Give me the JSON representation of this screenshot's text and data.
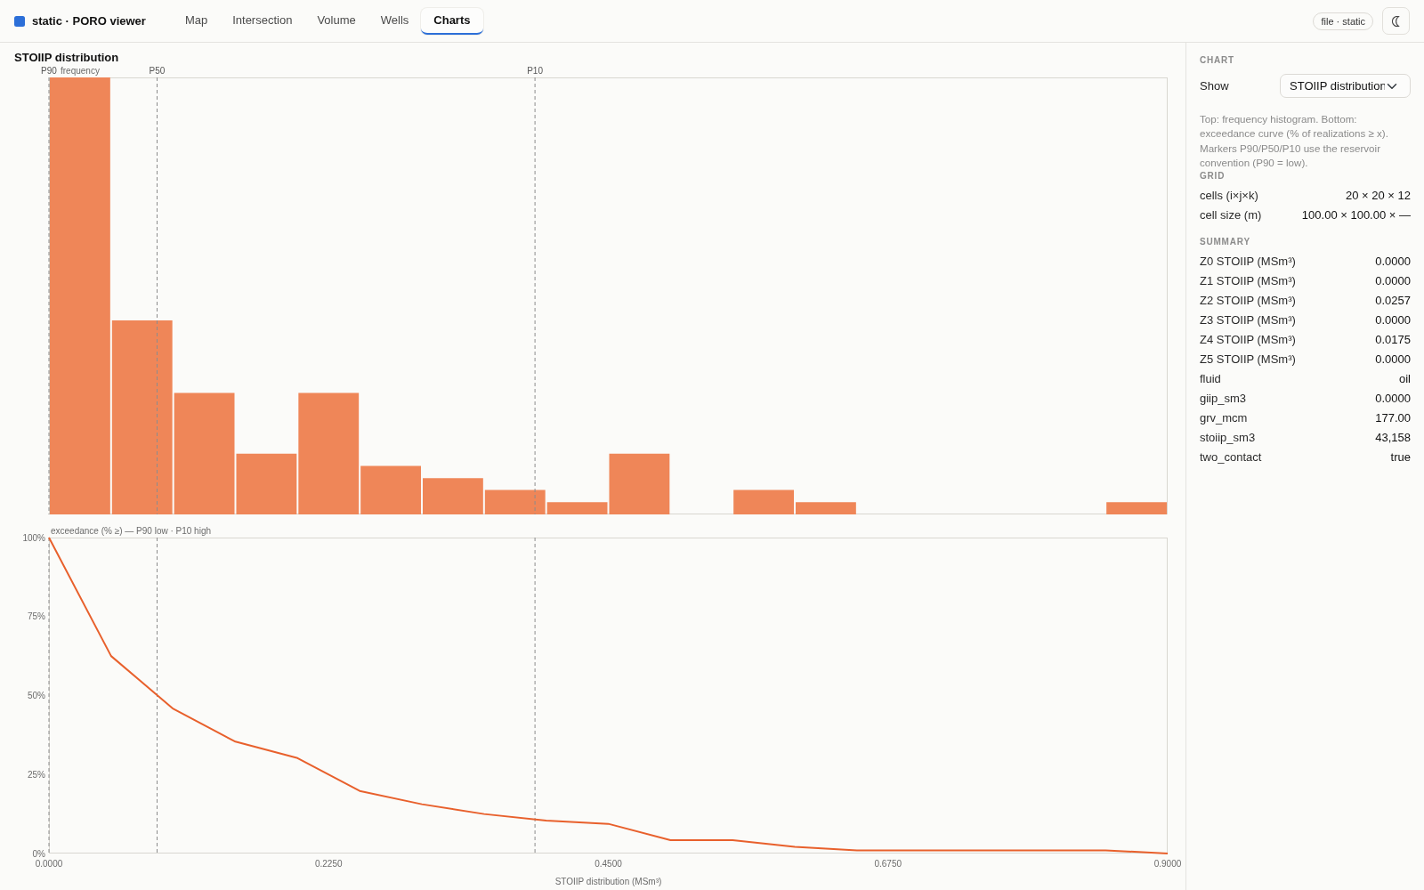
{
  "header": {
    "brand": "static · PORO viewer",
    "tabs": [
      {
        "label": "Map",
        "selected": false
      },
      {
        "label": "Intersection",
        "selected": false
      },
      {
        "label": "Volume",
        "selected": false
      },
      {
        "label": "Wells",
        "selected": false
      },
      {
        "label": "Charts",
        "selected": true
      }
    ],
    "file_badge": "file · static"
  },
  "chart_panel": {
    "title": "STOIIP distribution",
    "markers": [
      {
        "label": "P90"
      },
      {
        "label": "P50"
      },
      {
        "label": "P10"
      }
    ],
    "histogram": {
      "axis_label": "frequency"
    },
    "exceedance": {
      "chart_data": {
        "type": "line",
        "title": "exceedance (% ≥) — P90 low · P10 high",
        "xlabel": "STOIIP distribution (MSm³)",
        "x": [
          0,
          0.05,
          0.1,
          0.15,
          0.2,
          0.25,
          0.3,
          0.35,
          0.4,
          0.45,
          0.5,
          0.55,
          0.6,
          0.65,
          0.7,
          0.75,
          0.8,
          0.85,
          0.9
        ],
        "values": [
          100,
          62.5,
          45.8,
          35.4,
          30.2,
          19.8,
          15.6,
          12.5,
          10.4,
          9.4,
          4.2,
          4.2,
          2.1,
          1.0,
          1.0,
          1.0,
          1.0,
          1.0,
          0
        ],
        "xlim": [
          0,
          0.9
        ],
        "ylim": [
          0,
          100
        ],
        "xticks": [
          {
            "value": 0,
            "label": "0.0000"
          },
          {
            "value": 0.225,
            "label": "0.2250"
          },
          {
            "value": 0.45,
            "label": "0.4500"
          },
          {
            "value": 0.675,
            "label": "0.6750"
          },
          {
            "value": 0.9,
            "label": "0.9000"
          }
        ],
        "yticks": [
          {
            "value": 0,
            "label": "0%"
          },
          {
            "value": 25,
            "label": "25%"
          },
          {
            "value": 50,
            "label": "50%"
          },
          {
            "value": 75,
            "label": "75%"
          },
          {
            "value": 100,
            "label": "100%"
          }
        ],
        "ref_lines": [
          {
            "axis": "x",
            "value": 0
          },
          {
            "axis": "x",
            "value": 0.087
          },
          {
            "axis": "x",
            "value": 0.391
          }
        ]
      }
    }
  },
  "sidebar": {
    "chart_section": {
      "heading": "CHART",
      "show_label": "Show",
      "show_select": {
        "value": "STOIIP distribution"
      },
      "note": "Top: frequency histogram. Bottom: exceedance curve (% of realizations ≥ x). Markers P90/P50/P10 use the reservoir convention (P90 = low)."
    },
    "grid_section": {
      "heading": "GRID",
      "rows": [
        {
          "label": "cells (i×j×k)",
          "value": "20 × 20 × 12"
        },
        {
          "label": "cell size (m)",
          "value": "100.00 × 100.00 × —"
        }
      ]
    },
    "summary_section": {
      "heading": "SUMMARY",
      "rows": [
        {
          "label": "Z0 STOIIP (MSm³)",
          "value": "0.0000"
        },
        {
          "label": "Z1 STOIIP (MSm³)",
          "value": "0.0000"
        },
        {
          "label": "Z2 STOIIP (MSm³)",
          "value": "0.0257"
        },
        {
          "label": "Z3 STOIIP (MSm³)",
          "value": "0.0000"
        },
        {
          "label": "Z4 STOIIP (MSm³)",
          "value": "0.0175"
        },
        {
          "label": "Z5 STOIIP (MSm³)",
          "value": "0.0000"
        },
        {
          "label": "fluid",
          "value": "oil"
        },
        {
          "label": "giip_sm3",
          "value": "0.0000"
        },
        {
          "label": "grv_mcm",
          "value": "177.00"
        },
        {
          "label": "stoiip_sm3",
          "value": "43,158"
        },
        {
          "label": "two_contact",
          "value": "true"
        }
      ]
    }
  }
}
